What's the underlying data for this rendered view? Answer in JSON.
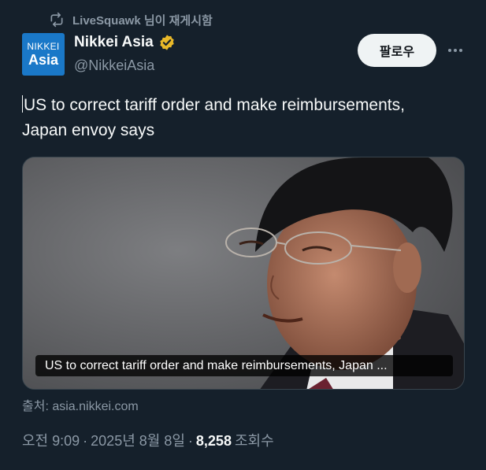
{
  "repost": {
    "label": "LiveSquawk 님이 재게시함",
    "icon": "repost-icon"
  },
  "author": {
    "avatar_line1": "NIKKEI",
    "avatar_line2": "Asia",
    "name": "Nikkei Asia",
    "handle": "@NikkeiAsia",
    "verified_color": "#e8b829"
  },
  "follow_label": "팔로우",
  "tweet": {
    "text_line1": "US to correct tariff order and make reimbursements,",
    "text_line2": "Japan envoy says"
  },
  "media": {
    "caption": "US to correct tariff order and make reimbursements, Japan ..."
  },
  "source": "출처: asia.nikkei.com",
  "meta": {
    "time": "오전 9:09",
    "sep1": "·",
    "date": "2025년 8월 8일",
    "sep2": "·",
    "views": "8,258",
    "views_label": "조회수"
  },
  "colors": {
    "background": "#15202b",
    "muted": "#8b98a5",
    "text": "#f7f9f9",
    "avatar": "#1a78c8"
  }
}
